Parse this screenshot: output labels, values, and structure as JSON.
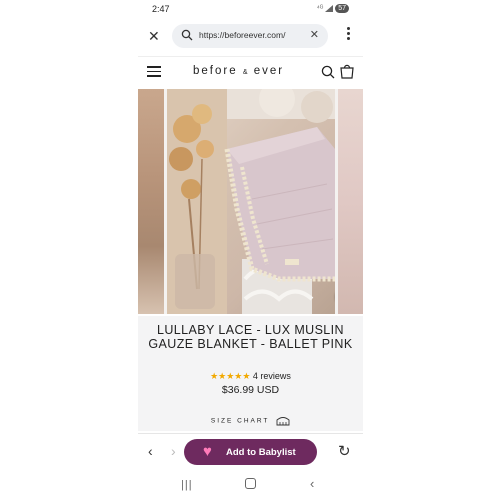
{
  "status_bar": {
    "time": "2:47",
    "signal_text": "⁴ᴳ",
    "battery": "57"
  },
  "browser": {
    "url": "https://beforeever.com/",
    "close_icon": "close-icon",
    "clear_icon": "clear-icon",
    "menu_icon": "more-vert-icon"
  },
  "site": {
    "logo_part1": "before",
    "logo_amp": "&",
    "logo_part2": "ever"
  },
  "product": {
    "title": "LULLABY LACE - LUX MUSLIN GAUZE BLANKET - BALLET PINK",
    "stars": "★★★★★",
    "reviews": "4 reviews",
    "price": "$36.99 USD",
    "size_chart": "SIZE CHART"
  },
  "toolbar": {
    "back": "‹",
    "forward": "›",
    "babylist_label": "Add to Babylist",
    "reload": "↻"
  },
  "navbar": {
    "recent": "|||",
    "back": "‹"
  },
  "colors": {
    "babylist_button": "#6e2a5f",
    "star": "#f2a900",
    "info_bg": "#f4f4f5"
  }
}
